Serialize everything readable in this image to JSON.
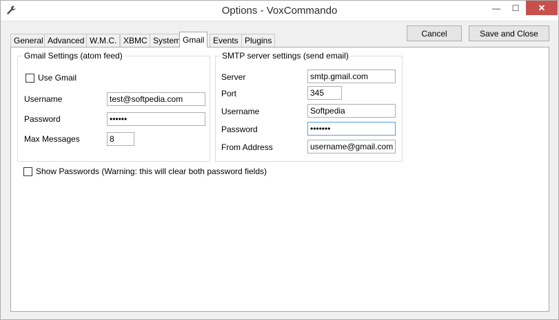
{
  "window": {
    "title": "Options - VoxCommando",
    "controls": {
      "minimize": "—",
      "maximize": "☐",
      "close": "✕"
    }
  },
  "buttons": {
    "cancel": "Cancel",
    "save_close": "Save and Close"
  },
  "tabs": [
    "General",
    "Advanced",
    "W.M.C.",
    "XBMC",
    "System",
    "Gmail",
    "Events",
    "Plugins"
  ],
  "active_tab": "Gmail",
  "gmail": {
    "legend": "Gmail Settings (atom feed)",
    "use_gmail_label": "Use Gmail",
    "use_gmail_checked": false,
    "username_label": "Username",
    "username_value": "test@softpedia.com",
    "password_label": "Password",
    "password_value": "••••••",
    "max_messages_label": "Max Messages",
    "max_messages_value": "8"
  },
  "smtp": {
    "legend": "SMTP server settings (send email)",
    "server_label": "Server",
    "server_value": "smtp.gmail.com",
    "port_label": "Port",
    "port_value": "345",
    "username_label": "Username",
    "username_value": "Softpedia",
    "password_label": "Password",
    "password_value": "•••••••",
    "from_label": "From Address",
    "from_value": "username@gmail.com"
  },
  "show_passwords": {
    "label": "Show Passwords (Warning: this will clear both password fields)",
    "checked": false
  },
  "colors": {
    "close_button": "#c7504d",
    "focus_border": "#569de5"
  }
}
